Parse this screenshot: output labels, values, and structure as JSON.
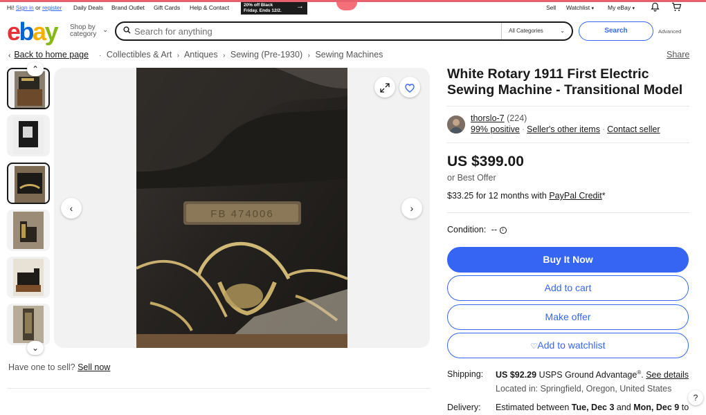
{
  "topnav": {
    "greeting_prefix": "Hi!",
    "sign_in": "Sign in",
    "or": "or",
    "register": "register",
    "daily_deals": "Daily Deals",
    "brand_outlet": "Brand Outlet",
    "gift_cards": "Gift Cards",
    "help_contact": "Help & Contact",
    "promo_line1": "20% off Black",
    "promo_line2": "Friday. Ends 12/2.",
    "sell": "Sell",
    "watchlist": "Watchlist",
    "my_ebay": "My eBay"
  },
  "header": {
    "logo": {
      "e": "e",
      "b": "b",
      "a": "a",
      "y": "y"
    },
    "shop_by_1": "Shop by",
    "shop_by_2": "category",
    "search_placeholder": "Search for anything",
    "category": "All Categories",
    "search_button": "Search",
    "advanced": "Advanced"
  },
  "breadcrumb": {
    "back": "Back to home page",
    "items": [
      "Collectibles & Art",
      "Antiques",
      "Sewing (Pre-1930)",
      "Sewing Machines"
    ],
    "share": "Share"
  },
  "gallery": {
    "thumbnail_count": 6,
    "selected_thumbnail": 3,
    "plate_text": "FB 474006"
  },
  "sell_prompt": {
    "text": "Have one to sell?",
    "link": "Sell now"
  },
  "item": {
    "title": "White Rotary 1911 First Electric Sewing Machine - Transitional Model",
    "seller_name": "thorslo-7",
    "seller_feedback": "(224)",
    "seller_positive": "99% positive",
    "seller_other_items": "Seller's other items",
    "contact_seller": "Contact seller",
    "price": "US $399.00",
    "best_offer": "or Best Offer",
    "paypal_prefix": "$33.25 for 12 months with",
    "paypal_link": "PayPal Credit",
    "paypal_suffix": "*",
    "condition_label": "Condition:",
    "condition_value": "--",
    "buy_now": "Buy It Now",
    "add_to_cart": "Add to cart",
    "make_offer": "Make offer",
    "add_to_watchlist": "Add to watchlist",
    "shipping_label": "Shipping:",
    "shipping_price": "US $92.29",
    "shipping_service": "USPS Ground Advantage",
    "shipping_reg": "®",
    "see_details": "See details",
    "located_in": "Located in: Springfield, Oregon, United States",
    "delivery_label": "Delivery:",
    "delivery_prefix": "Estimated between",
    "delivery_start": "Tue, Dec 3",
    "delivery_and": "and",
    "delivery_end": "Mon, Dec 9",
    "delivery_to": "to"
  },
  "colors": {
    "accent": "#3665f3",
    "logo_red": "#e53238",
    "logo_blue": "#0064d2",
    "logo_yellow": "#f5af02",
    "logo_green": "#86b817"
  }
}
